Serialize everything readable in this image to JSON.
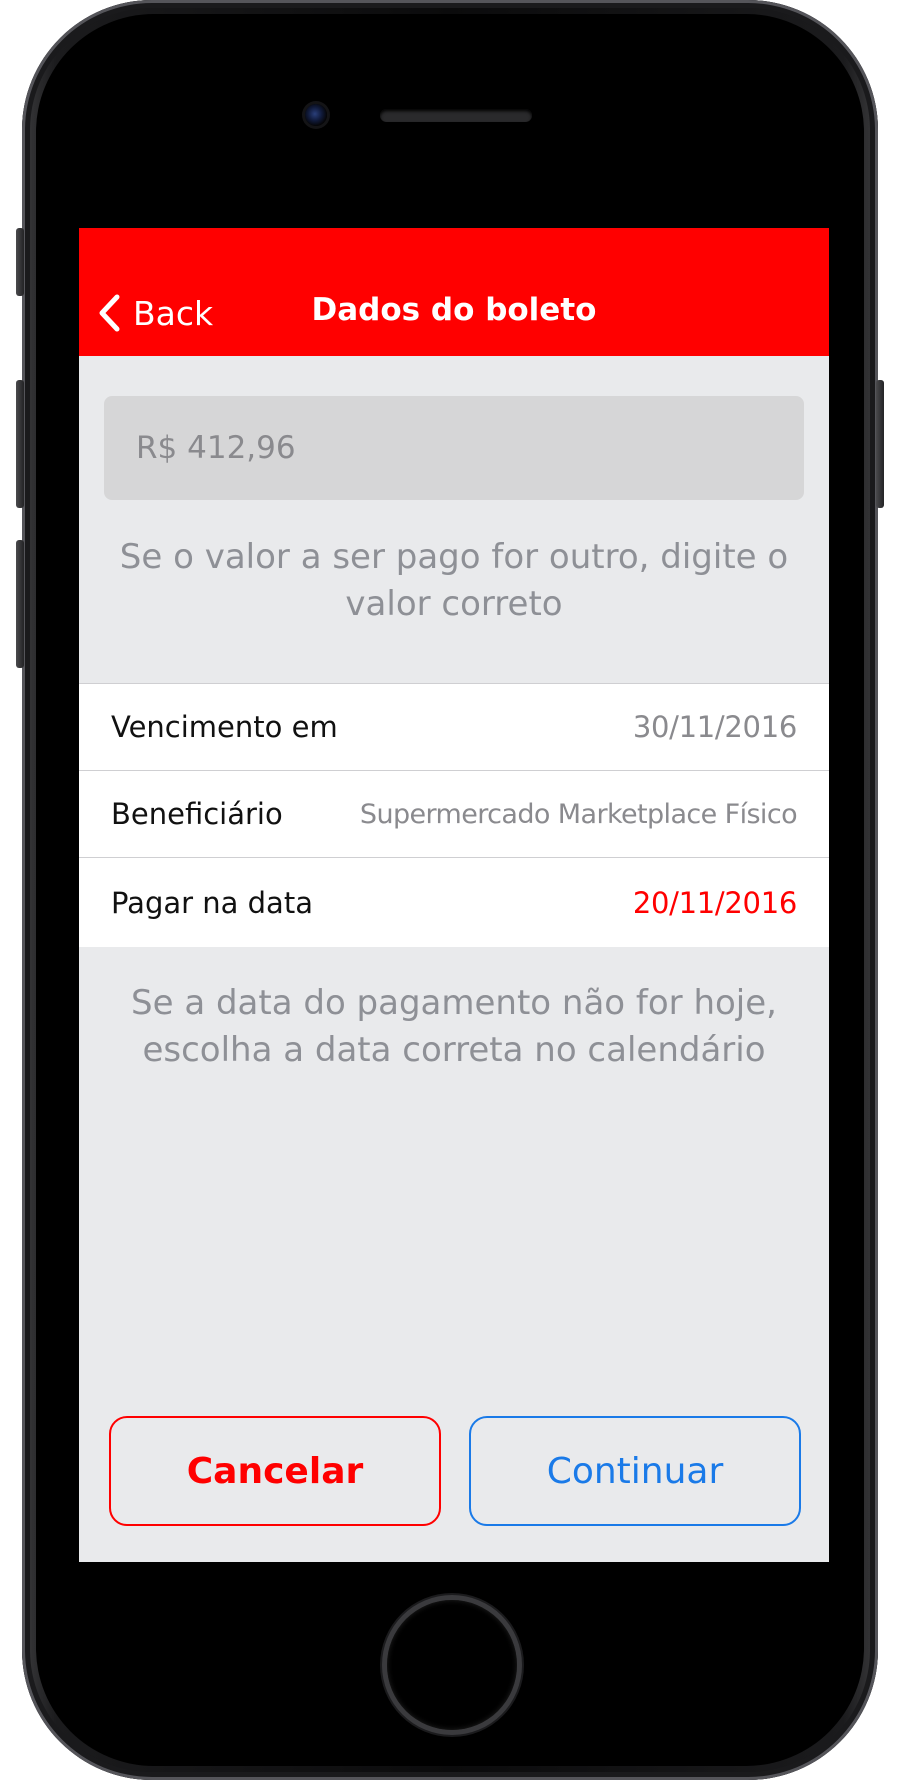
{
  "navbar": {
    "back_label": "Back",
    "title": "Dados do boleto"
  },
  "amount": {
    "value": "R$ 412,96",
    "hint": "Se o valor a ser pago for outro, digite o valor correto"
  },
  "details": {
    "rows": [
      {
        "label": "Vencimento em",
        "value": "30/11/2016"
      },
      {
        "label": "Beneficiário",
        "value": "Supermercado Marketplace Físico"
      },
      {
        "label": "Pagar na data",
        "value": "20/11/2016"
      }
    ]
  },
  "date_hint": "Se a data do pagamento não for hoje, escolha a data correta no calendário",
  "actions": {
    "cancel_label": "Cancelar",
    "continue_label": "Continuar"
  },
  "colors": {
    "brand_red": "#ff0000",
    "link_blue": "#1a7ae8",
    "background": "#e9eaec"
  },
  "icons": {
    "back": "chevron-left-icon"
  }
}
